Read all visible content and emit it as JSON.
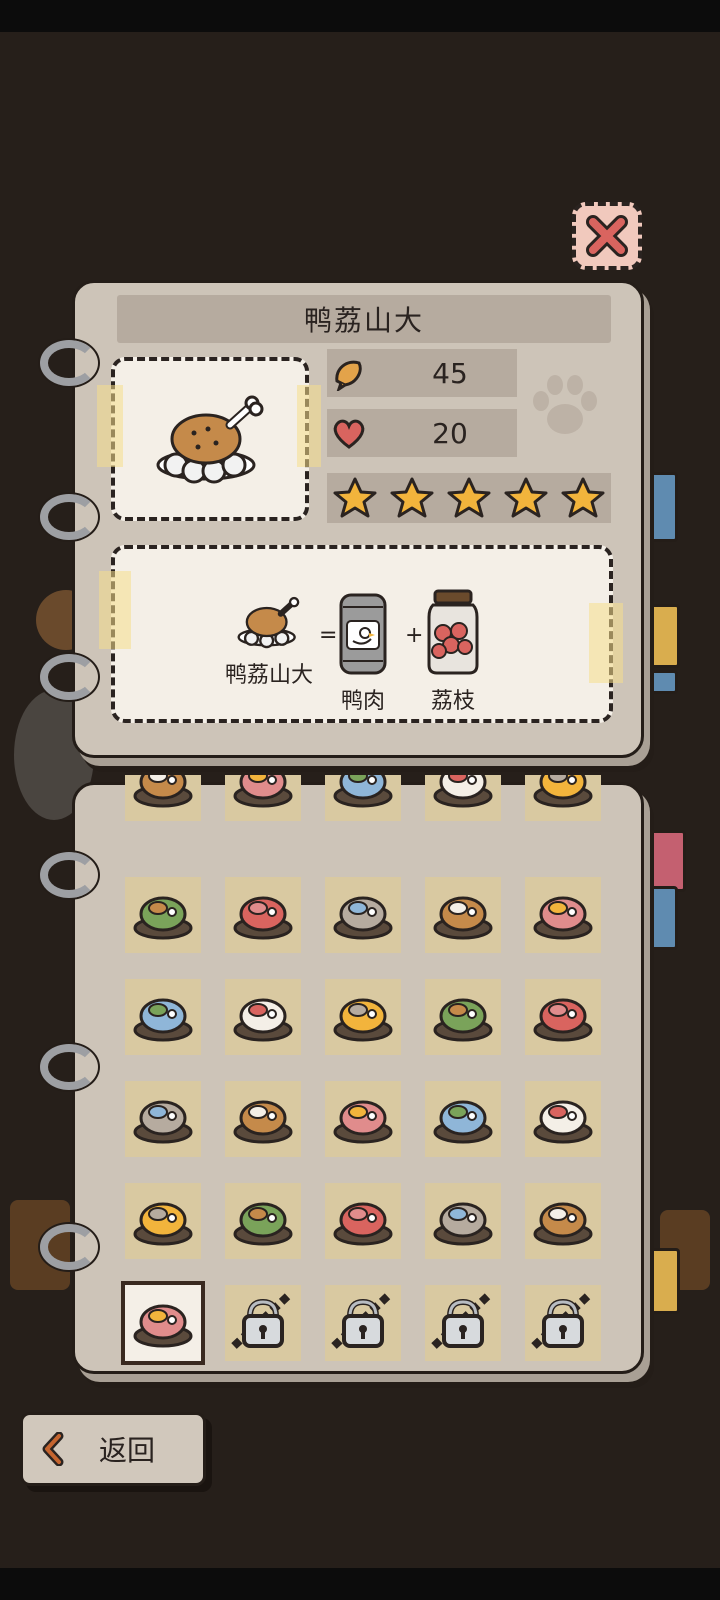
{
  "dish": {
    "name": "鸭荔山大",
    "price": "45",
    "love": "20",
    "stars": 5
  },
  "recipe": {
    "result_label": "鸭荔山大",
    "eq": "=",
    "plus": "+",
    "ingredients": [
      {
        "label": "鸭肉",
        "icon": "duck-can-icon"
      },
      {
        "label": "荔枝",
        "icon": "lychee-jar-icon"
      }
    ]
  },
  "grid": {
    "rows": [
      [
        "wood-bucket-icon",
        "cake-icon",
        "bunny-cake-icon",
        "milk-jar-icon",
        "lidded-jar-icon"
      ],
      [
        "cream-parfait-icon",
        "cherry-parfait-icon",
        "blue-parfait-icon",
        "sandwich-icon",
        "fried-egg-icon"
      ],
      [
        "dumpling-plate-icon",
        "meat-roll-icon",
        "carrot-sushi-icon",
        "cucumber-roll-icon",
        "kiwi-sushi-icon"
      ],
      [
        "salmon-sushi-icon",
        "mushroom-sushi-icon",
        "shrimp-sushi-icon",
        "egg-sushi-icon",
        "veg-sushi-icon"
      ],
      [
        "eel-sushi-icon",
        "tuna-sushi-icon",
        "berry-bowl-icon",
        "fruit-salad-icon",
        "bacon-bowl-icon"
      ],
      [
        "duck-dish-icon",
        "lock-icon",
        "lock-icon",
        "lock-icon",
        "lock-icon"
      ]
    ],
    "selected": "duck-dish-icon"
  },
  "nav": {
    "back_label": "返回"
  },
  "colors": {
    "page": "#cdc4b8",
    "cell": "#d9c9a1",
    "star": "#f2b43c",
    "heart": "#d9645f",
    "close_bg": "#f1c9bd",
    "tab_blue": "#5f8bb0",
    "tab_yellow": "#d9ad4e",
    "tab_pink": "#c46070"
  }
}
